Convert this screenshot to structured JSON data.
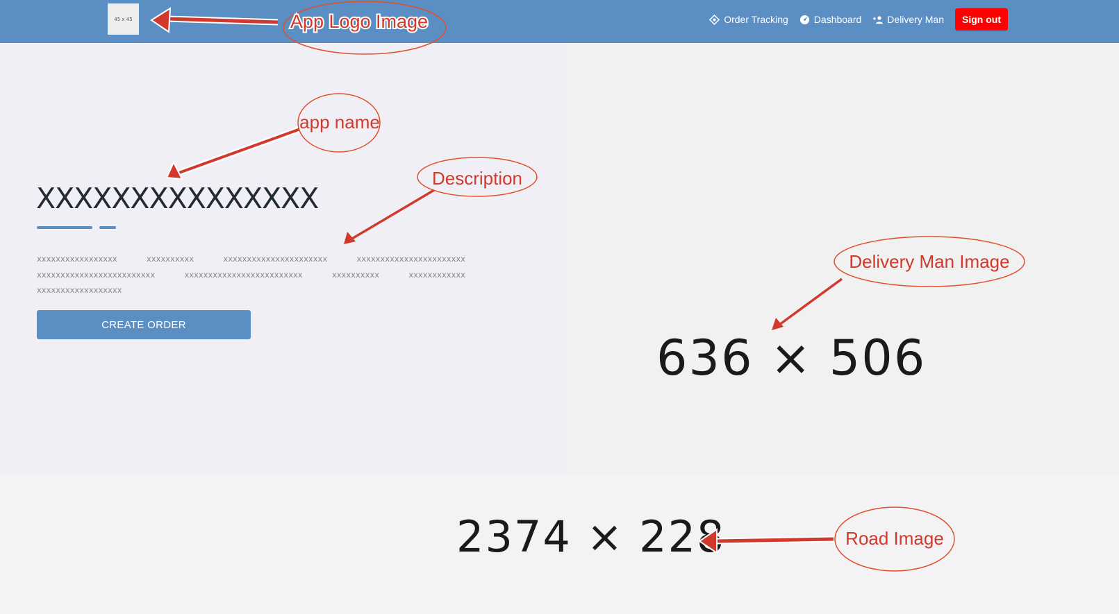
{
  "navbar": {
    "logo_text": "45 x 45",
    "links": [
      {
        "label": "Order Tracking",
        "icon": "location-target-icon"
      },
      {
        "label": "Dashboard",
        "icon": "speedometer-icon"
      },
      {
        "label": "Delivery Man",
        "icon": "add-person-icon"
      }
    ],
    "signout_label": "Sign out"
  },
  "hero": {
    "app_name": "XXXXXXXXXXXXXXX",
    "description": "xxxxxxxxxxxxxxxxx xxxxxxxxxx xxxxxxxxxxxxxxxxxxxxxx xxxxxxxxxxxxxxxxxxxxxxx xxxxxxxxxxxxxxxxxxxxxxxxx xxxxxxxxxxxxxxxxxxxxxxxxx xxxxxxxxxx xxxxxxxxxxxx xxxxxxxxxxxxxxxxxx",
    "create_button_label": "CREATE ORDER",
    "delivery_image_text": "636 × 506"
  },
  "road": {
    "image_text": "2374 × 228"
  },
  "annotations": {
    "logo": "App Logo Image",
    "app_name": "app name",
    "description": "Description",
    "delivery_image": "Delivery Man Image",
    "road_image": "Road Image"
  },
  "colors": {
    "navbar": "#5b8ec2",
    "signout": "#ff0000",
    "annotation": "#d0392c"
  }
}
